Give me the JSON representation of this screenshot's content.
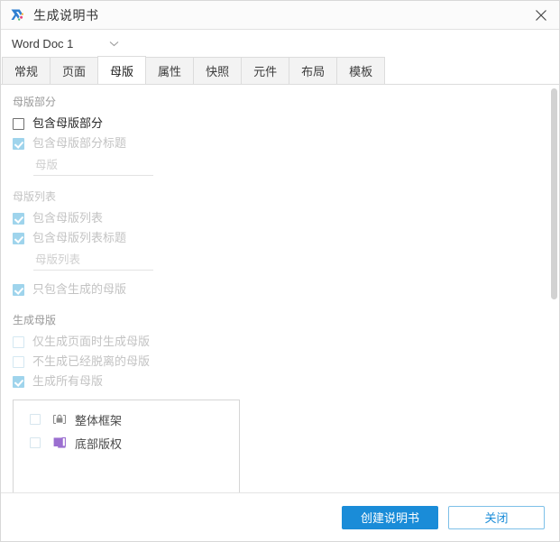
{
  "window": {
    "title": "生成说明书",
    "app_icon": "axure-x-logo-icon",
    "close_icon": "close-icon"
  },
  "doc_selector": {
    "value": "Word Doc 1",
    "caret_icon": "chevron-down-icon"
  },
  "tabs": [
    {
      "label": "常规",
      "active": false
    },
    {
      "label": "页面",
      "active": false
    },
    {
      "label": "母版",
      "active": true
    },
    {
      "label": "属性",
      "active": false
    },
    {
      "label": "快照",
      "active": false
    },
    {
      "label": "元件",
      "active": false
    },
    {
      "label": "布局",
      "active": false
    },
    {
      "label": "模板",
      "active": false
    }
  ],
  "sections": {
    "master_section": {
      "title": "母版部分",
      "include_master_section": {
        "label": "包含母版部分",
        "checked": false,
        "disabled": false
      },
      "include_master_section_title": {
        "label": "包含母版部分标题",
        "checked": true,
        "disabled": true
      },
      "title_field": {
        "value": "",
        "placeholder": "母版"
      }
    },
    "master_list": {
      "title": "母版列表",
      "include_master_list": {
        "label": "包含母版列表",
        "checked": true,
        "disabled": true
      },
      "include_master_list_title": {
        "label": "包含母版列表标题",
        "checked": true,
        "disabled": true
      },
      "list_title_field": {
        "value": "",
        "placeholder": "母版列表"
      },
      "only_generated": {
        "label": "只包含生成的母版",
        "checked": true,
        "disabled": true
      }
    },
    "generate_masters": {
      "title": "生成母版",
      "only_when_page_generated": {
        "label": "仅生成页面时生成母版",
        "checked": false,
        "disabled": true
      },
      "skip_detached": {
        "label": "不生成已经脱离的母版",
        "checked": false,
        "disabled": true
      },
      "generate_all": {
        "label": "生成所有母版",
        "checked": true,
        "disabled": true
      }
    }
  },
  "master_listbox": {
    "items": [
      {
        "label": "整体框架",
        "checked": false,
        "icon": "master-lock-icon",
        "icon_color": "#8c8c8c"
      },
      {
        "label": "底部版权",
        "checked": false,
        "icon": "master-shape-icon",
        "icon_color": "#9b6fd0"
      }
    ]
  },
  "scrollbar": {
    "name": "vertical-scrollbar"
  },
  "footer": {
    "primary_label": "创建说明书",
    "secondary_label": "关闭"
  },
  "colors": {
    "accent": "#1a8cd8",
    "checkbox_disabled_checked": "#9fd4ec",
    "purple_icon": "#9b6fd0"
  }
}
